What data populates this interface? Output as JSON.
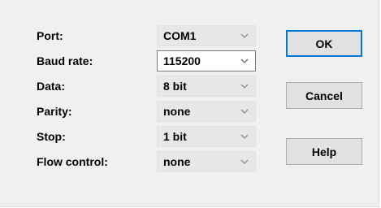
{
  "fields": [
    {
      "label": "Port:",
      "value": "COM1"
    },
    {
      "label": "Baud rate:",
      "value": "115200"
    },
    {
      "label": "Data:",
      "value": "8 bit"
    },
    {
      "label": "Parity:",
      "value": "none"
    },
    {
      "label": "Stop:",
      "value": "1 bit"
    },
    {
      "label": "Flow control:",
      "value": "none"
    }
  ],
  "buttons": {
    "ok": "OK",
    "cancel": "Cancel",
    "help": "Help"
  },
  "colors": {
    "dialog_bg": "#f0f0f0",
    "focus_border": "#0078d7"
  },
  "icons": {
    "dropdown": "chevron-down-icon"
  }
}
